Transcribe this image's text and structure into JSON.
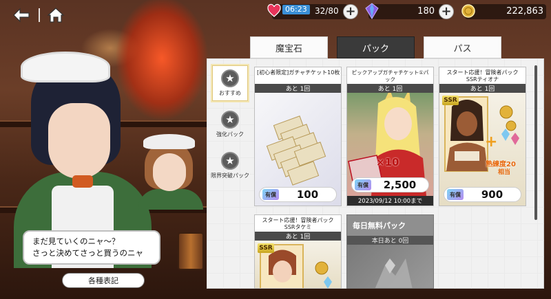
{
  "topbar": {
    "stamina_time": "06:23",
    "stamina_value": "32/80",
    "gems": "180",
    "coins": "222,863",
    "plus_symbol": "+"
  },
  "tabs": [
    {
      "label": "魔宝石"
    },
    {
      "label": "パック"
    },
    {
      "label": "パス"
    }
  ],
  "categories": [
    {
      "label": "おすすめ"
    },
    {
      "label": "強化パック"
    },
    {
      "label": "限界突破パック"
    }
  ],
  "cards": [
    {
      "title": "[初心者限定]ガチャチケット10枚",
      "count": "あと 1回",
      "paid": "有償",
      "price": "100"
    },
    {
      "title": "ピックアップガチャチケット①パック",
      "count": "あと 1回",
      "paid": "有償",
      "price": "2,500",
      "ticket_multiplier": "×10",
      "date": "2023/09/12 10:00まで"
    },
    {
      "title_line1": "スタート応援！冒険者パック",
      "title_line2": "SSRティオナ",
      "count": "あと 1回",
      "paid": "有償",
      "price": "900",
      "ssr": "SSR",
      "bonus_label": "熟練度20",
      "bonus_sub": "相当"
    },
    {
      "title_line1": "スタート応援！冒険者パック",
      "title_line2": "SSRタケミ",
      "count": "あと 1回",
      "ssr": "SSR"
    },
    {
      "title": "毎日無料パック",
      "count": "本日あと 0回"
    }
  ],
  "dialog": {
    "line1": "まだ見ていくのニャ〜？",
    "line2": "さっと決めてさっと買うのニャ",
    "button": "各種表記"
  }
}
